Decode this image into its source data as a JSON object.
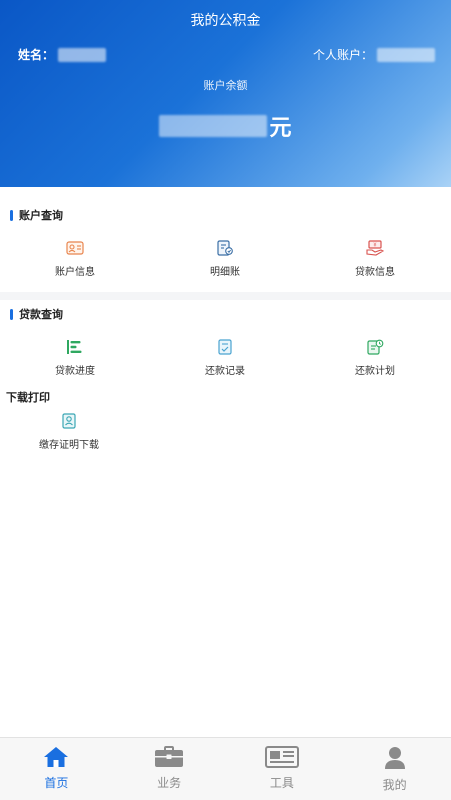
{
  "header": {
    "title": "我的公积金",
    "name_label": "姓名：",
    "account_label": "个人账户：",
    "balance_label": "账户余额",
    "balance_unit": "元"
  },
  "sections": {
    "account": {
      "title": "账户查询",
      "items": [
        {
          "label": "账户信息",
          "icon": "id-card-icon"
        },
        {
          "label": "明细账",
          "icon": "ledger-icon"
        },
        {
          "label": "贷款信息",
          "icon": "loan-info-icon"
        }
      ]
    },
    "loan": {
      "title": "贷款查询",
      "items": [
        {
          "label": "贷款进度",
          "icon": "progress-icon"
        },
        {
          "label": "还款记录",
          "icon": "repayment-record-icon"
        },
        {
          "label": "还款计划",
          "icon": "repayment-plan-icon"
        }
      ]
    },
    "download": {
      "title": "下载打印",
      "items": [
        {
          "label": "缴存证明下载",
          "icon": "certificate-icon"
        }
      ]
    }
  },
  "tabbar": {
    "items": [
      {
        "label": "首页",
        "icon": "home-icon",
        "active": true
      },
      {
        "label": "业务",
        "icon": "briefcase-icon",
        "active": false
      },
      {
        "label": "工具",
        "icon": "newspaper-icon",
        "active": false
      },
      {
        "label": "我的",
        "icon": "user-icon",
        "active": false
      }
    ]
  },
  "colors": {
    "accent": "#1a6fe0",
    "header_start": "#0a57c6",
    "header_end": "#a9d2f6",
    "inactive_tab": "#8a8a8a"
  }
}
